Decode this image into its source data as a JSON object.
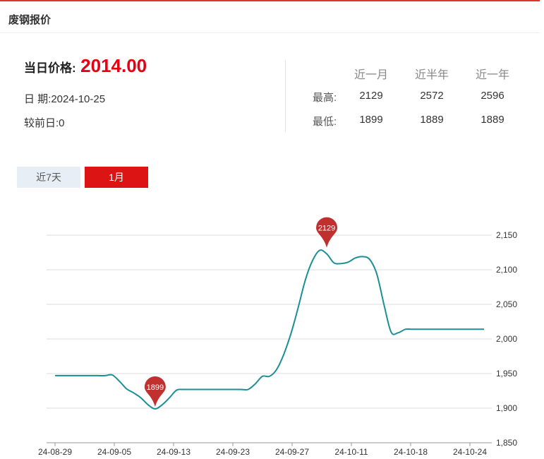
{
  "header": {
    "title": "废钢报价"
  },
  "summary": {
    "price_label": "当日价格:",
    "price_value": "2014.00",
    "date_text": "日 期:2024-10-25",
    "change_text": "较前日:0"
  },
  "stats": {
    "headers": [
      "近一月",
      "近半年",
      "近一年"
    ],
    "rows": [
      {
        "label": "最高:",
        "values": [
          "2129",
          "2572",
          "2596"
        ]
      },
      {
        "label": "最低:",
        "values": [
          "1899",
          "1889",
          "1889"
        ]
      }
    ]
  },
  "tabs": [
    {
      "label": "近7天",
      "active": false
    },
    {
      "label": "1月",
      "active": true
    }
  ],
  "colors": {
    "accent": "#dd1414",
    "price": "#e60012",
    "line": "#1a8f94",
    "pin": "#c0302f"
  },
  "chart_data": {
    "type": "line",
    "title": "",
    "xlabel": "",
    "ylabel": "",
    "ylim": [
      1850,
      2150
    ],
    "yticks": [
      1850,
      1900,
      1950,
      2000,
      2050,
      2100,
      2150
    ],
    "ytick_labels": [
      "1,850",
      "1,900",
      "1,950",
      "2,000",
      "2,050",
      "2,100",
      "2,150"
    ],
    "x_tick_labels": [
      "24-08-29",
      "24-09-05",
      "24-09-13",
      "24-09-23",
      "24-09-27",
      "24-10-11",
      "24-10-18",
      "24-10-24"
    ],
    "grid": true,
    "series": [
      {
        "x": [
          "2024-08-26",
          "2024-08-27",
          "2024-08-28",
          "2024-08-29",
          "2024-08-30",
          "2024-08-31",
          "2024-09-01",
          "2024-09-02",
          "2024-09-03",
          "2024-09-04",
          "2024-09-05",
          "2024-09-06",
          "2024-09-07",
          "2024-09-08",
          "2024-09-09",
          "2024-09-10",
          "2024-09-11",
          "2024-09-12",
          "2024-09-13",
          "2024-09-14",
          "2024-09-15",
          "2024-09-16",
          "2024-09-17",
          "2024-09-18",
          "2024-09-19",
          "2024-09-20",
          "2024-09-21",
          "2024-09-22",
          "2024-09-23",
          "2024-09-24",
          "2024-09-25",
          "2024-09-26",
          "2024-09-27",
          "2024-09-28",
          "2024-09-29",
          "2024-09-30",
          "2024-10-01",
          "2024-10-02",
          "2024-10-03",
          "2024-10-04",
          "2024-10-05",
          "2024-10-06",
          "2024-10-07",
          "2024-10-08",
          "2024-10-09",
          "2024-10-10",
          "2024-10-11",
          "2024-10-12",
          "2024-10-13",
          "2024-10-14",
          "2024-10-15",
          "2024-10-16",
          "2024-10-17",
          "2024-10-18",
          "2024-10-19",
          "2024-10-20",
          "2024-10-21",
          "2024-10-22",
          "2024-10-23",
          "2024-10-24",
          "2024-10-25"
        ],
        "values": [
          1947,
          1947,
          1947,
          1947,
          1947,
          1947,
          1947,
          1947,
          1948,
          1939,
          1928,
          1922,
          1915,
          1905,
          1899,
          1905,
          1915,
          1926,
          1927,
          1927,
          1927,
          1927,
          1927,
          1927,
          1927,
          1927,
          1927,
          1927,
          1935,
          1946,
          1946,
          1956,
          1978,
          2008,
          2045,
          2085,
          2113,
          2128,
          2123,
          2110,
          2109,
          2111,
          2117,
          2119,
          2115,
          2094,
          2050,
          2010,
          2009,
          2014,
          2014,
          2014,
          2014,
          2014,
          2014,
          2014,
          2014,
          2014,
          2014,
          2014,
          2014
        ]
      }
    ],
    "annotations": [
      {
        "label": "2129",
        "x": "2024-10-03",
        "y": 2129
      },
      {
        "label": "1899",
        "x": "2024-09-09",
        "y": 1899
      }
    ]
  }
}
